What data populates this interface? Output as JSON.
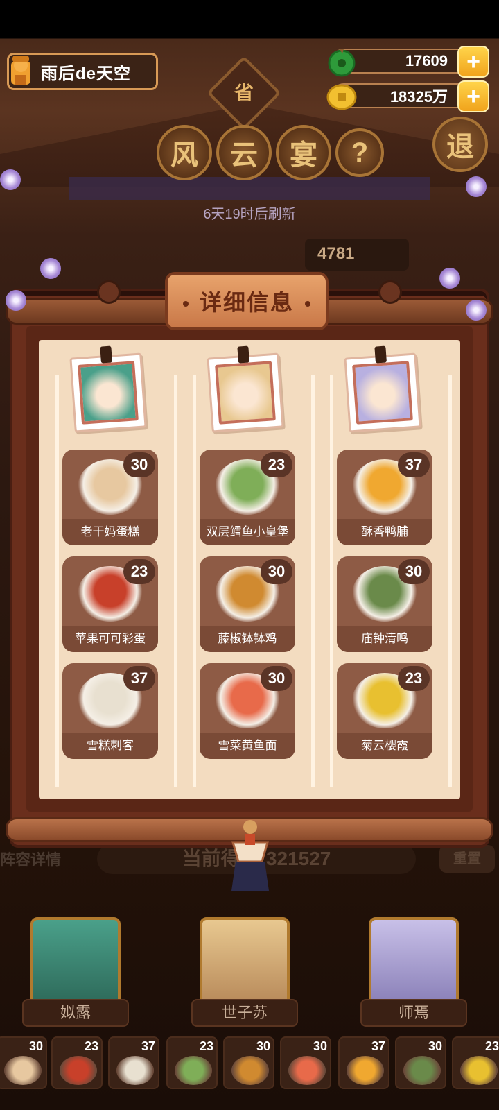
{
  "player": {
    "name": "雨后de天空",
    "avatar_icon": "cook-avatar-icon"
  },
  "currencies": {
    "jade": {
      "value": "17609",
      "icon": "jade-icon"
    },
    "coin": {
      "value": "18325万",
      "icon": "coin-icon"
    },
    "plus_label": "+"
  },
  "event": {
    "province": "省",
    "title_chars": [
      "风",
      "云",
      "宴"
    ],
    "help_label": "?",
    "exit_label": "退",
    "refresh_text": "6天19时后刷新",
    "bg_score": "4781"
  },
  "modal": {
    "title": "详细信息",
    "columns": [
      {
        "character": "姒露",
        "dishes": [
          {
            "name": "老干妈蛋糕",
            "level": "30",
            "color": "#e7c8a0"
          },
          {
            "name": "苹果可可彩蛋",
            "level": "23",
            "color": "#c8402a"
          },
          {
            "name": "雪糕刺客",
            "level": "37",
            "color": "#e8e0d0"
          }
        ]
      },
      {
        "character": "世子苏",
        "dishes": [
          {
            "name": "双层鳕鱼小皇堡",
            "level": "23",
            "color": "#7fae58"
          },
          {
            "name": "藤椒钵钵鸡",
            "level": "30",
            "color": "#d08a30"
          },
          {
            "name": "雪菜黄鱼面",
            "level": "30",
            "color": "#e86a4a"
          }
        ]
      },
      {
        "character": "师焉",
        "dishes": [
          {
            "name": "酥香鸭脯",
            "level": "37",
            "color": "#f0a830"
          },
          {
            "name": "庙钟清鸣",
            "level": "30",
            "color": "#6a8a4a"
          },
          {
            "name": "菊云樱霞",
            "level": "23",
            "color": "#e8c030"
          }
        ]
      }
    ]
  },
  "bottom": {
    "lineup_label": "阵容详情",
    "score_text": "当前得分:321527",
    "reset_label": "重置",
    "characters": [
      "姒露",
      "世子苏",
      "师焉"
    ],
    "mini_levels": [
      "30",
      "23",
      "37",
      "23",
      "30",
      "30",
      "37",
      "30",
      "23"
    ]
  },
  "colors": {
    "accent": "#f0a31c",
    "frame": "#6a2e1c",
    "paper": "#f3dcc0",
    "card": "#8e5b45"
  }
}
